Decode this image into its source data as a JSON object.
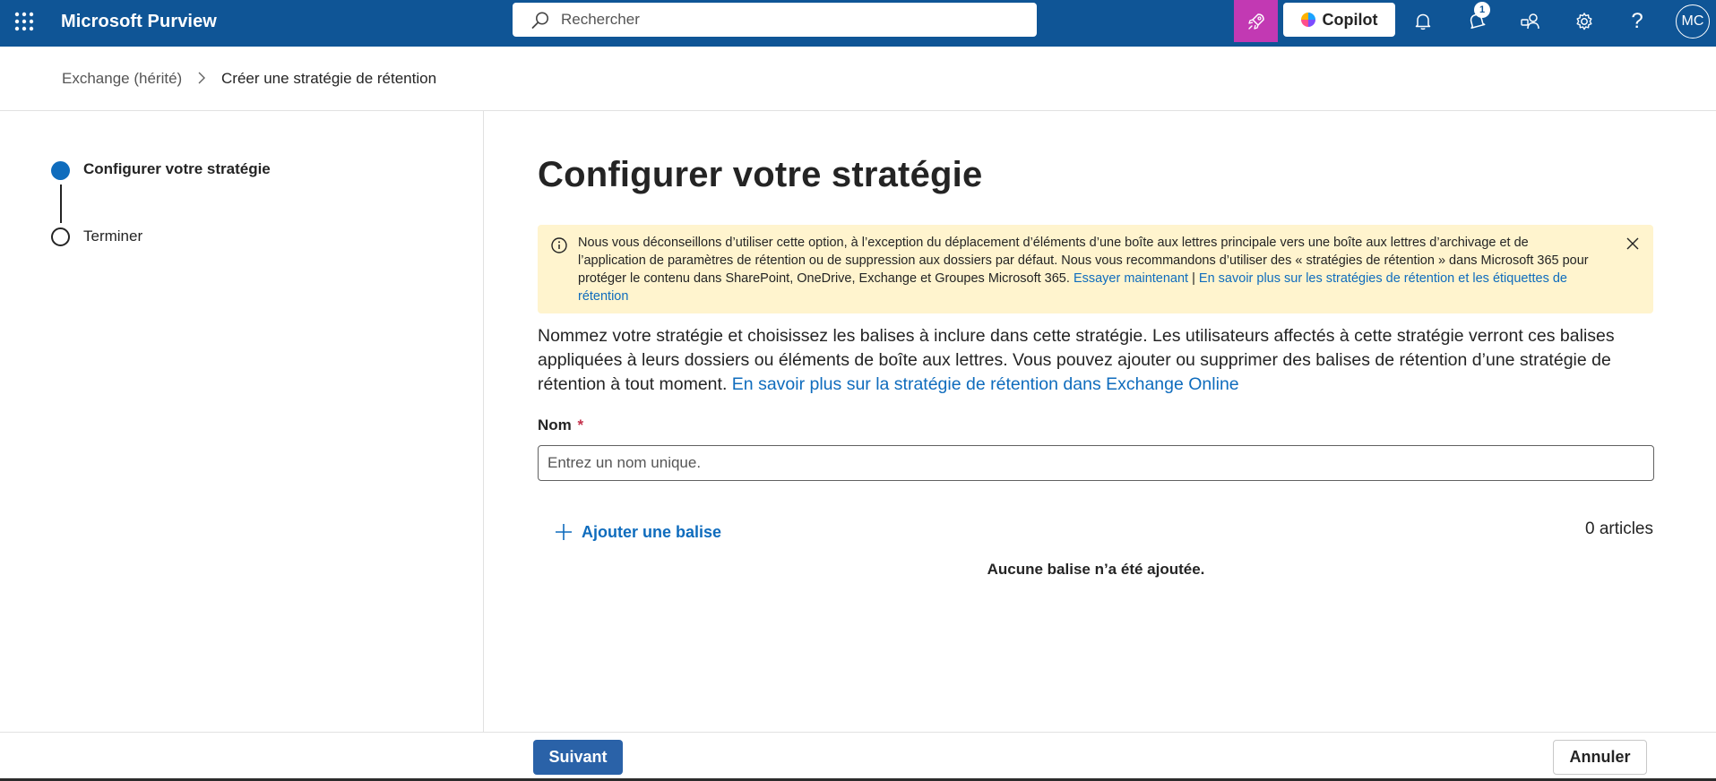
{
  "header": {
    "app_title": "Microsoft Purview",
    "search_placeholder": "Rechercher",
    "copilot_label": "Copilot",
    "notification_count": "1",
    "avatar_initials": "MC",
    "bar_color": "#0f5596",
    "rocket_color": "#c239b3",
    "icons": [
      "app-launcher-icon",
      "search-icon",
      "rocket-icon",
      "copilot-logo-icon",
      "bell-icon",
      "notifications-icon",
      "people-icon",
      "gear-icon",
      "help-icon"
    ]
  },
  "breadcrumb": {
    "parent": "Exchange (hérité)",
    "current": "Créer une stratégie de rétention"
  },
  "steps": [
    {
      "label": "Configurer votre stratégie",
      "state": "current"
    },
    {
      "label": "Terminer",
      "state": "pending"
    }
  ],
  "main": {
    "title": "Configurer votre stratégie",
    "notice": {
      "text": "Nous vous déconseillons d’utiliser cette option, à l’exception du déplacement d’éléments d’une boîte aux lettres principale vers une boîte aux lettres d’archivage et de l’application de paramètres de rétention ou de suppression aux dossiers par défaut. Nous vous recommandons d’utiliser des « stratégies de rétention » dans Microsoft 365 pour protéger le contenu dans SharePoint, OneDrive, Exchange et Groupes Microsoft 365. ",
      "link_try": "Essayer maintenant",
      "separator": " | ",
      "link_learn": "En savoir plus sur les stratégies de rétention et les étiquettes de rétention"
    },
    "description": "Nommez votre stratégie et choisissez les balises à inclure dans cette stratégie. Les utilisateurs affectés à cette stratégie verront ces balises appliquées à leurs dossiers ou éléments de boîte aux lettres. Vous pouvez ajouter ou supprimer des balises de rétention d’une stratégie de rétention à tout moment. ",
    "description_link": "En savoir plus sur la stratégie de rétention dans Exchange Online",
    "name_label": "Nom",
    "name_required_mark": "*",
    "name_placeholder": "Entrez un nom unique.",
    "name_value": "",
    "add_tag_label": "Ajouter une balise",
    "item_count": "0 articles",
    "empty_message": "Aucune balise n’a été ajoutée."
  },
  "footer": {
    "next_label": "Suivant",
    "cancel_label": "Annuler"
  },
  "colors": {
    "accent": "#0f6cbd",
    "notice_bg": "#fff4ce",
    "primary_button": "#2a62a8"
  }
}
